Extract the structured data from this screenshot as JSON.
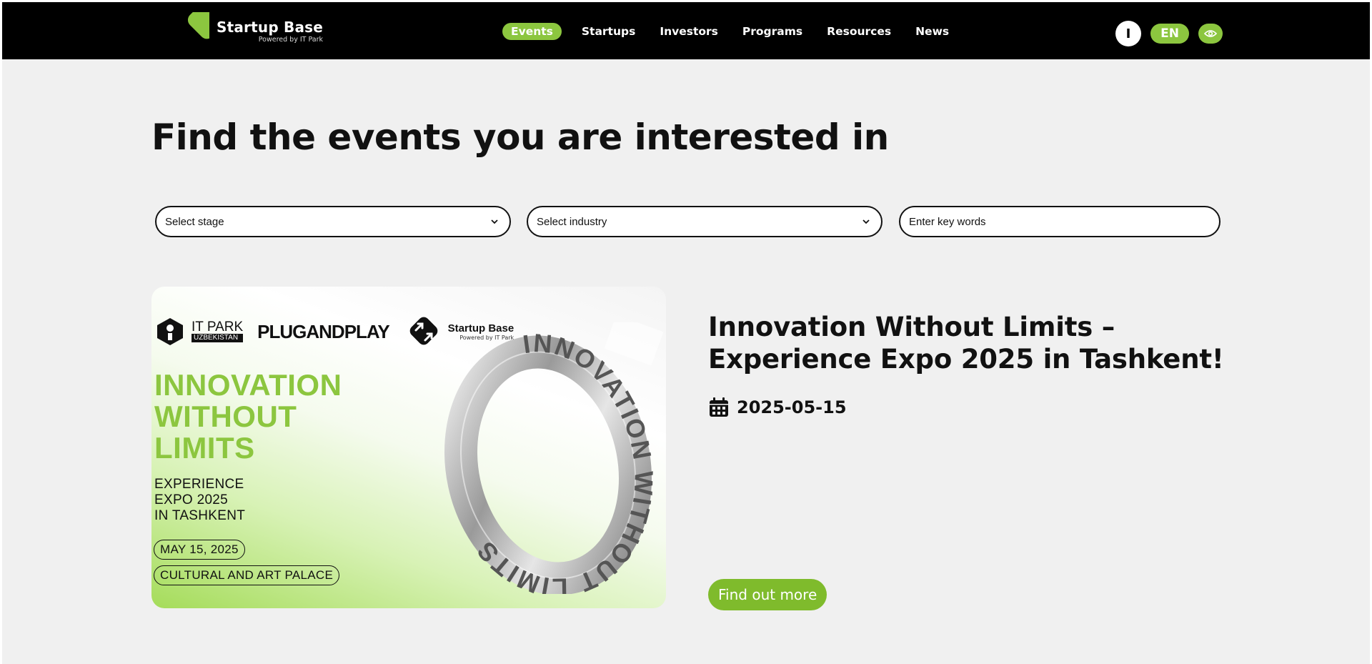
{
  "header": {
    "logo_title": "Startup Base",
    "logo_sub": "Powered by IT Park",
    "nav": [
      "Events",
      "Startups",
      "Investors",
      "Programs",
      "Resources",
      "News"
    ],
    "theme_label": "I",
    "lang_label": "EN"
  },
  "main": {
    "title": "Find the events you are interested in",
    "filters": {
      "stage_placeholder": "Select stage",
      "industry_placeholder": "Select industry",
      "keywords_placeholder": "Enter key words"
    }
  },
  "event": {
    "image": {
      "itpark_top": "IT PARK",
      "itpark_bottom": "UZBEKISTAN",
      "pnp": "PLUGANDPLAY",
      "sb_title": "Startup Base",
      "sb_sub": "Powered by IT Park",
      "headline": [
        "INNOVATION",
        "WITHOUT",
        "LIMITS"
      ],
      "subline": [
        "EXPERIENCE",
        "EXPO 2025",
        "IN TASHKENT"
      ],
      "date_pill": "MAY 15, 2025",
      "venue_pill": "CULTURAL AND ART PALACE",
      "art_text": "INNOVATION WITHOUT LIMITS"
    },
    "title": "Innovation Without Limits – Experience Expo 2025 in Tashkent!",
    "date": "2025-05-15",
    "cta": "Find out more"
  },
  "colors": {
    "brand_green": "#8cc63f",
    "header_bg": "#000000",
    "page_bg": "#f0f0f0"
  },
  "icons": [
    "logo-mark-icon",
    "eye-icon",
    "chevron-down-icon",
    "calendar-icon"
  ]
}
